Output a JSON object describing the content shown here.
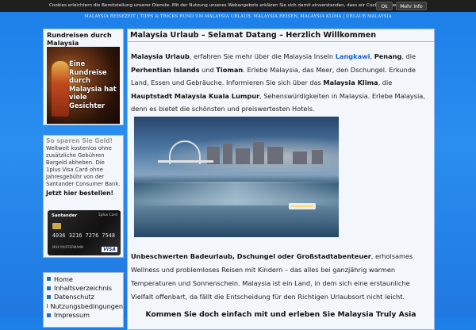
{
  "cookie_bar": {
    "text": "Cookies erleichtern die Bereitstellung unserer Dienste. Mit der Nutzung unseres Webangebots erklären Sie sich damit einverstanden, dass wir Cookies verwenden.",
    "ok_label": "Ok",
    "more_label": "Mehr Info"
  },
  "top_nav": {
    "text": "MALAYSIA REISEZEIT | TIPPS & TRICKS RUND UM MALAYSIA URLAUB, MALAYSIA REISEN, MALAYSIA KLIMA | URLAUB MALAYSIA"
  },
  "sidebar": {
    "tours": {
      "title": "Rundreisen durch Malaysia",
      "image_text": "Eine Rundreise durch Malaysia hat viele Gesichter"
    },
    "promo": {
      "title": "So sparen Sie Geld!",
      "body": "Weltweit kostenlos ohne zusätzliche Gebühren Bargeld abheben. Die 1plus Visa Card ohne Jahresgebühr von der Santander Consumer Bank.",
      "cta": "Jetzt hier bestellen!",
      "card": {
        "brand": "Santander",
        "type": "1plus Card",
        "number": "4036 3216 7276 7548",
        "name": "MAX MUSTERMANN",
        "network": "VISA"
      }
    },
    "nav": {
      "items": [
        {
          "label": "Home"
        },
        {
          "label": "Inhaltsverzeichnis"
        },
        {
          "label": "Datenschutz"
        },
        {
          "label": "Nutzungsbedingungen"
        },
        {
          "label": "Impressum"
        }
      ]
    }
  },
  "main": {
    "title": "Malaysia Urlaub – Selamat Datang – Herzlich Willkommen",
    "intro": {
      "t1": "Malaysia Urlaub",
      "t2": ", erfahren Sie mehr über die Malaysia Inseln ",
      "link": "Langkawi",
      "t3": ", ",
      "t4": "Penang",
      "t5": ", die ",
      "t6": "Perhentian Islands",
      "t7": " und ",
      "t8": "Tioman",
      "t9": ". Erlebe Malaysia, das Meer, den Dschungel. Erkunde Land, Essen und Gebräuche. Informieren Sie sich über das ",
      "t10": "Malaysia Klima",
      "t11": ", die ",
      "t12": "Hauptstadt Malaysia Kuala Lumpur",
      "t13": ", Sehenswürdigkeiten in Malaysia. Erlebe Malaysia, denn es bietet die schönsten und preiswertesten Hotels."
    },
    "para2": {
      "bold": "Unbeschwerten Badeurlaub, Dschungel oder Großstadtabenteuer",
      "rest": ", erholsames Wellness und problemloses Reisen mit Kindern – das alles bei ganzjährig warmen Temperaturen und Sonnenschein. Malaysia ist ein Land, in dem sich eine erstaunliche Vielfalt offenbart, da fällt die Entscheidung für den Richtigen Urlaubsort nicht leicht."
    },
    "cta": "Kommen Sie doch einfach mit und erleben Sie Malaysia Truly Asia"
  }
}
